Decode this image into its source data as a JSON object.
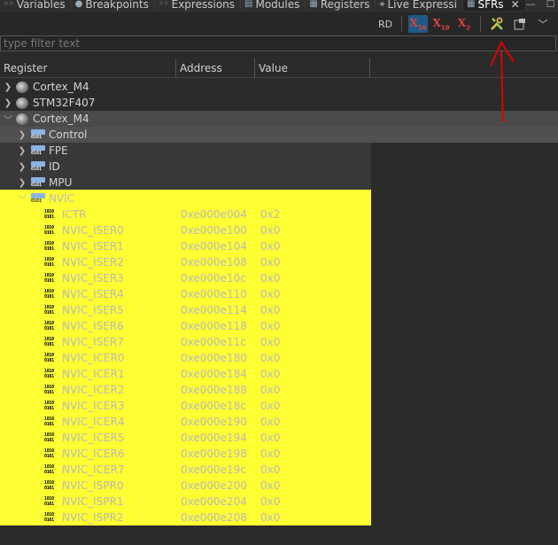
{
  "tabs": [
    {
      "label": "Variables",
      "icon": "variables-icon"
    },
    {
      "label": "Breakpoints",
      "icon": "breakpoints-icon"
    },
    {
      "label": "Expressions",
      "icon": "expressions-icon"
    },
    {
      "label": "Modules",
      "icon": "modules-icon"
    },
    {
      "label": "Registers",
      "icon": "registers-icon"
    },
    {
      "label": "Live Expressi",
      "icon": "live-expressions-icon"
    },
    {
      "label": "SFRs",
      "icon": "sfrs-icon"
    }
  ],
  "toolbar": {
    "rd_label": "RD",
    "hex_label": "X",
    "hex_sub": "16",
    "dec_label": "X",
    "dec_sub": "10",
    "bin_label": "X",
    "bin_sub": "2"
  },
  "filter": {
    "placeholder": "type filter text",
    "value": ""
  },
  "columns": [
    "Register",
    "Address",
    "Value"
  ],
  "tree": {
    "roots": [
      {
        "label": "Cortex_M4",
        "expanded": false
      },
      {
        "label": "STM32F407",
        "expanded": false
      },
      {
        "label": "Cortex_M4",
        "expanded": true
      }
    ],
    "groups": [
      {
        "label": "Control",
        "expanded": false
      },
      {
        "label": "FPE",
        "expanded": false
      },
      {
        "label": "ID",
        "expanded": false
      },
      {
        "label": "MPU",
        "expanded": false
      },
      {
        "label": "NVIC",
        "expanded": true
      }
    ],
    "registers": [
      {
        "name": "ICTR",
        "address": "0xe000e004",
        "value": "0x2"
      },
      {
        "name": "NVIC_ISER0",
        "address": "0xe000e100",
        "value": "0x0"
      },
      {
        "name": "NVIC_ISER1",
        "address": "0xe000e104",
        "value": "0x0"
      },
      {
        "name": "NVIC_ISER2",
        "address": "0xe000e108",
        "value": "0x0"
      },
      {
        "name": "NVIC_ISER3",
        "address": "0xe000e10c",
        "value": "0x0"
      },
      {
        "name": "NVIC_ISER4",
        "address": "0xe000e110",
        "value": "0x0"
      },
      {
        "name": "NVIC_ISER5",
        "address": "0xe000e114",
        "value": "0x0"
      },
      {
        "name": "NVIC_ISER6",
        "address": "0xe000e118",
        "value": "0x0"
      },
      {
        "name": "NVIC_ISER7",
        "address": "0xe000e11c",
        "value": "0x0"
      },
      {
        "name": "NVIC_ICER0",
        "address": "0xe000e180",
        "value": "0x0"
      },
      {
        "name": "NVIC_ICER1",
        "address": "0xe000e184",
        "value": "0x0"
      },
      {
        "name": "NVIC_ICER2",
        "address": "0xe000e188",
        "value": "0x0"
      },
      {
        "name": "NVIC_ICER3",
        "address": "0xe000e18c",
        "value": "0x0"
      },
      {
        "name": "NVIC_ICER4",
        "address": "0xe000e190",
        "value": "0x0"
      },
      {
        "name": "NVIC_ICER5",
        "address": "0xe000e194",
        "value": "0x0"
      },
      {
        "name": "NVIC_ICER6",
        "address": "0xe000e198",
        "value": "0x0"
      },
      {
        "name": "NVIC_ICER7",
        "address": "0xe000e19c",
        "value": "0x0"
      },
      {
        "name": "NVIC_ISPR0",
        "address": "0xe000e200",
        "value": "0x0"
      },
      {
        "name": "NVIC_ISPR1",
        "address": "0xe000e204",
        "value": "0x0"
      },
      {
        "name": "NVIC_ISPR2",
        "address": "0xe000e208",
        "value": "0x0"
      }
    ]
  },
  "colors": {
    "highlight": "#ffff33",
    "annotation_arrow": "#e00000",
    "selected_tab": "#232323"
  }
}
